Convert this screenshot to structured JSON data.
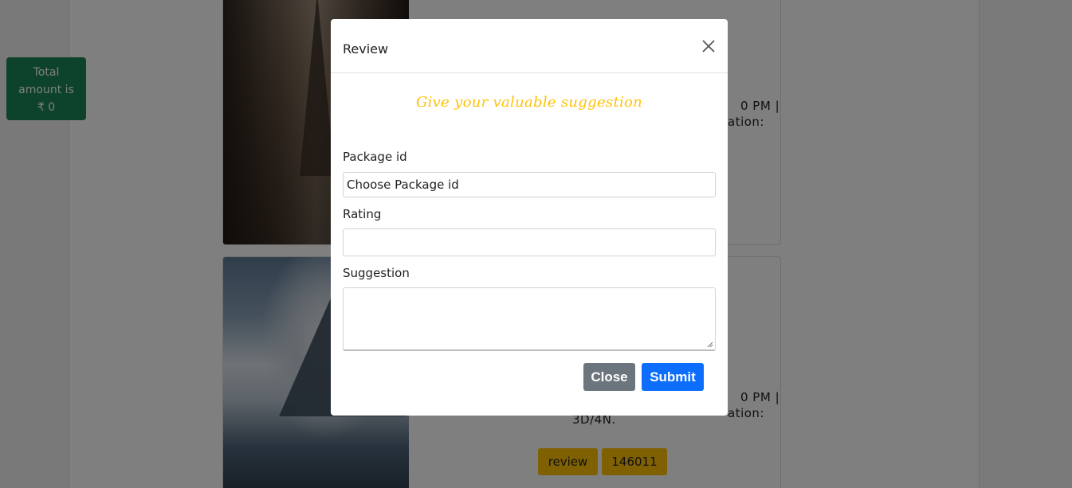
{
  "background": {
    "total_box": {
      "line1": "Total",
      "line2": "amount is",
      "line3": "₹ 0"
    },
    "card_text_1": "0 PM |",
    "card_text_1b": "ation:",
    "card_text_2": "0 PM |",
    "card_text_2b": "ation:",
    "card_text_3": "3D/4N.",
    "review_badge": "review",
    "id_badge": "146011"
  },
  "modal": {
    "title": "Review",
    "slogan": "Give your valuable suggestion",
    "package_label": "Package id",
    "package_value": "Choose Package id",
    "rating_label": "Rating",
    "rating_value": "",
    "suggestion_label": "Suggestion",
    "suggestion_value": "",
    "close_label": "Close",
    "submit_label": "Submit"
  },
  "colors": {
    "accent_yellow": "#ffc107",
    "submit_blue": "#0d6efd",
    "close_gray": "#6c757d",
    "total_green": "#198754"
  },
  "icons": {
    "close": "close-icon"
  }
}
